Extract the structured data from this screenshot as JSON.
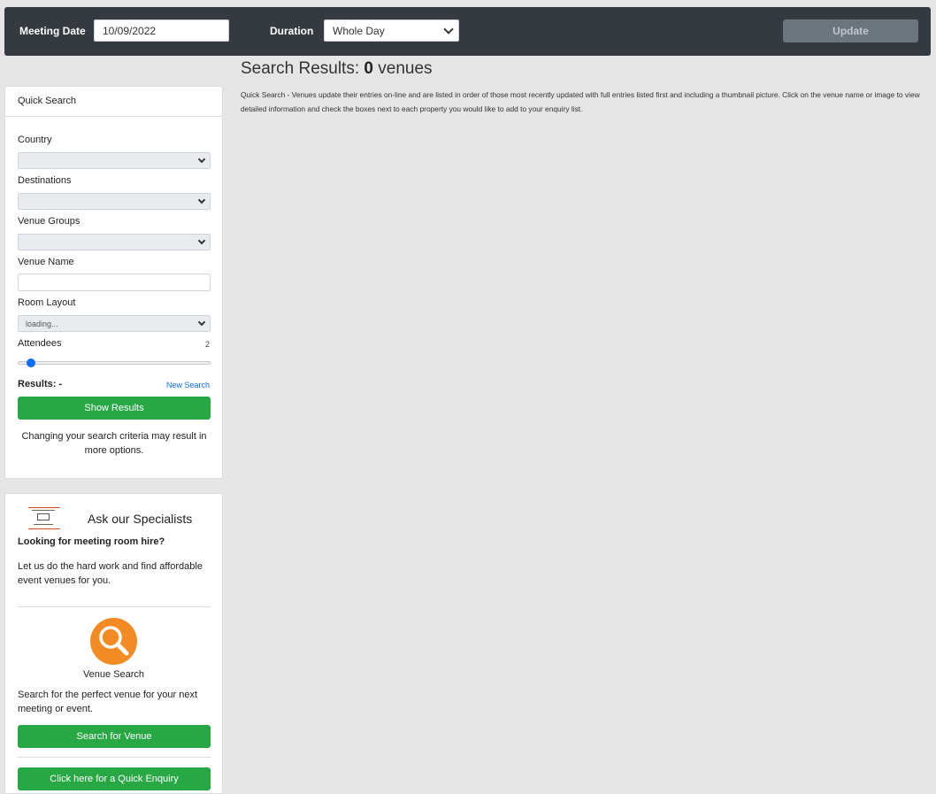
{
  "topbar": {
    "meeting_date_label": "Meeting Date",
    "meeting_date_value": "10/09/2022",
    "duration_label": "Duration",
    "duration_value": "Whole Day",
    "update_label": "Update"
  },
  "results": {
    "title_prefix": "Search Results:",
    "count": "0",
    "title_suffix": "venues",
    "description": "Quick Search - Venues update their entries on-line and are listed in order of those most recently updated with full entries listed first and including a thumbnail picture. Click on the venue name or image to view detailed information and check the boxes next to each property you would like to add to your enquiry list."
  },
  "quick_search": {
    "header": "Quick Search",
    "country_label": "Country",
    "destinations_label": "Destinations",
    "venue_groups_label": "Venue Groups",
    "venue_name_label": "Venue Name",
    "room_layout_label": "Room Layout",
    "room_layout_value": "loading...",
    "attendees_label": "Attendees",
    "attendees_value": "2",
    "results_label": "Results: -",
    "new_search_label": "New Search",
    "show_results_label": "Show Results",
    "note": "Changing your search criteria may result in more options."
  },
  "specialists": {
    "title": "Ask our Specialists",
    "subtitle": "Looking for meeting room hire?",
    "text": "Let us do the hard work and find affordable event venues for you.",
    "venue_search_label": "Venue Search",
    "venue_search_text": "Search for the perfect venue for your next meeting or event.",
    "search_venue_button": "Search for Venue",
    "quick_enquiry_button": "Click here for a Quick Enquiry"
  },
  "colors": {
    "topbar_bg": "#343a40",
    "accent_green": "#28a745",
    "accent_orange": "#f38b24",
    "link_blue": "#0d6efd"
  }
}
